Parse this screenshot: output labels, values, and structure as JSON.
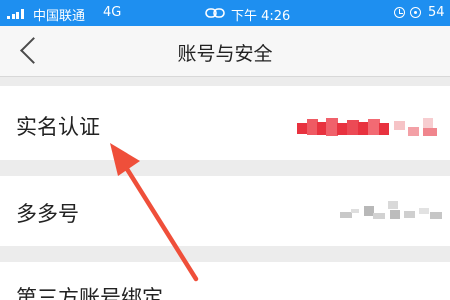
{
  "status_bar": {
    "carrier": "中国联通",
    "network": "4G",
    "time": "下午 4:26",
    "battery": "54"
  },
  "nav": {
    "title": "账号与安全",
    "back_icon": "chevron-left-icon"
  },
  "rows": [
    {
      "label": "实名认证",
      "value": "redacted"
    },
    {
      "label": "多多号",
      "value": "redacted"
    },
    {
      "label": "第三方账号绑定"
    }
  ],
  "colors": {
    "status_bar": "#1e8ff0",
    "page_background": "#ececec",
    "annotation_arrow": "#ef4f3a",
    "redaction_red": "#e8323f"
  }
}
